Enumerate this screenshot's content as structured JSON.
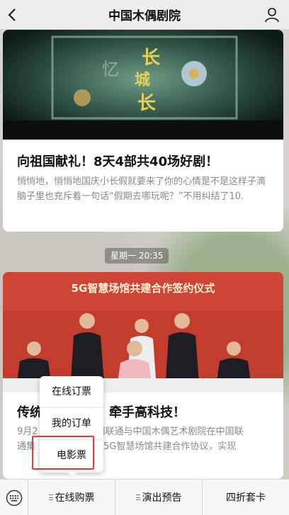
{
  "nav": {
    "title": "中国木偶剧院"
  },
  "articles": [
    {
      "title": "向祖国献礼！8天4部共40场好剧！",
      "desc": "悄悄地，悄悄地国庆小长假就要来了你的心情是不是这样子滴脑子里也充斥着一句话“假期去哪玩呢？”不用纠结了10.",
      "image_text": "长城长"
    },
    {
      "title": "传统艺术牵手高科技！",
      "title_left": "传统",
      "title_right": "牵手高科技！",
      "desc_line1_left": "9月2",
      "desc_line1_right": "国联通与中国木偶艺术剧院在中国联",
      "desc_line2_left": "通集",
      "desc_line2_right": "5G智慧场馆共建合作协议，实现",
      "image_text": "5G智慧场馆共建合作签约仪式"
    }
  ],
  "timestamp": "星期一 20:35",
  "popup_menu": {
    "items": [
      "在线订票",
      "我的订单",
      "电影票"
    ]
  },
  "bottom_menu": {
    "items": [
      "在线购票",
      "演出预告",
      "四折套卡"
    ]
  },
  "colors": {
    "highlight": "#e23a3a",
    "image2_bg": "#c33d2e"
  }
}
